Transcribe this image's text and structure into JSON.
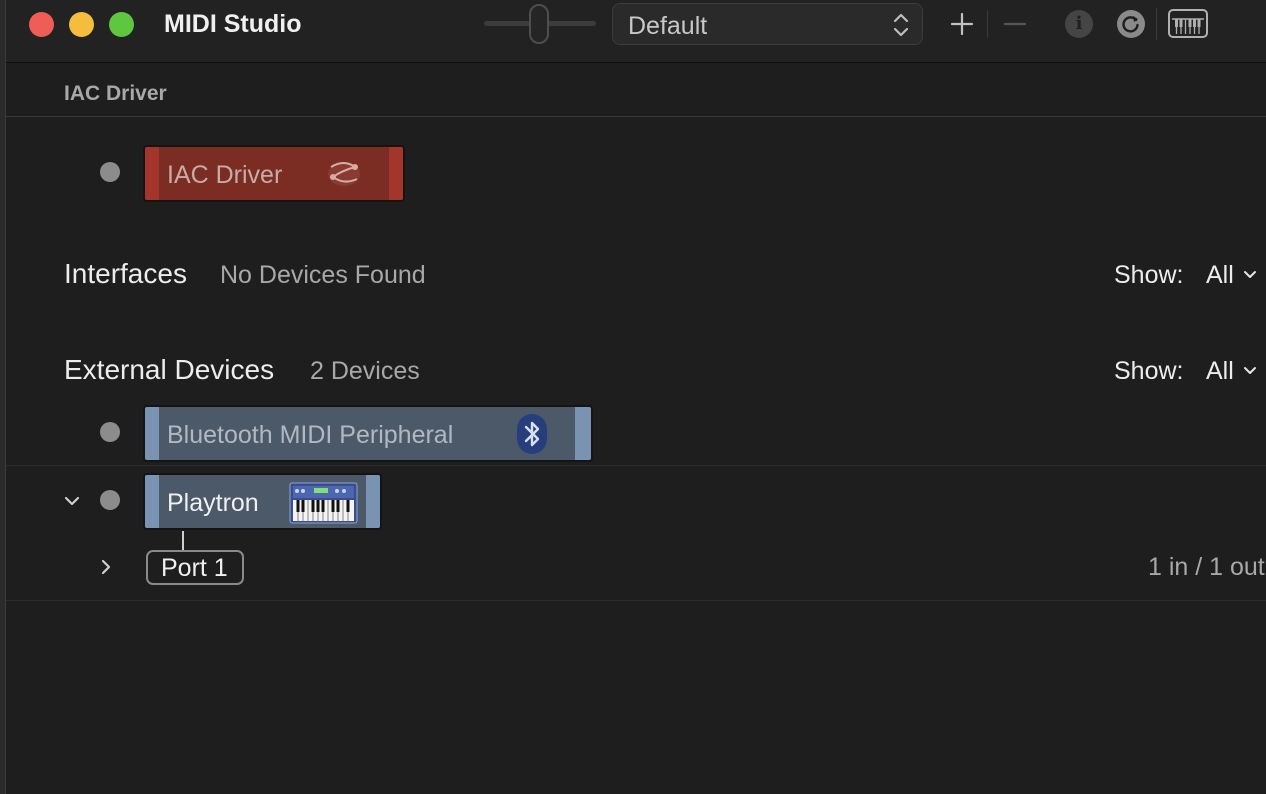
{
  "window": {
    "title": "MIDI Studio"
  },
  "toolbar": {
    "configuration_value": "Default",
    "add_icon": "plus-icon",
    "remove_icon": "minus-icon",
    "info_icon": "info-icon",
    "info_glyph": "i",
    "rescan_icon": "refresh-icon",
    "keyboard_icon": "piano-keyboard-icon"
  },
  "iac_section": {
    "header": "IAC Driver",
    "device": {
      "name": "IAC Driver",
      "icon": "iac-driver-icon",
      "color": "#7b2d23"
    }
  },
  "interfaces": {
    "title": "Interfaces",
    "status": "No Devices Found",
    "show_label": "Show:",
    "show_value": "All"
  },
  "external_devices": {
    "title": "External Devices",
    "count": "2 Devices",
    "show_label": "Show:",
    "show_value": "All",
    "devices": [
      {
        "name": "Bluetooth MIDI Peripheral",
        "icon": "bluetooth-icon",
        "color": "#4b5969"
      },
      {
        "name": "Playtron",
        "icon": "synthesizer-keyboard-icon",
        "color": "#4b5969",
        "expanded": true,
        "ports": [
          {
            "name": "Port 1",
            "info": "1 in / 1 out"
          }
        ]
      }
    ]
  }
}
